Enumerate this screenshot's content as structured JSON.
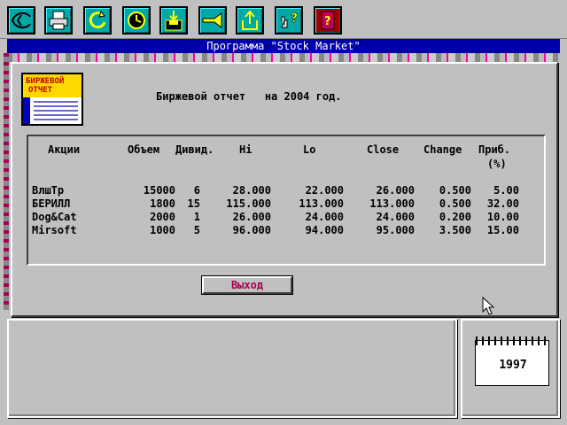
{
  "toolbar": {
    "buttons": [
      {
        "name": "exit-icon"
      },
      {
        "name": "printer-icon"
      },
      {
        "name": "refresh-icon"
      },
      {
        "name": "clock-icon"
      },
      {
        "name": "save-icon"
      },
      {
        "name": "trumpet-icon"
      },
      {
        "name": "upload-icon"
      },
      {
        "name": "help-hand-icon"
      },
      {
        "name": "book-icon"
      }
    ]
  },
  "window": {
    "title": "Программа \"Stock Market\""
  },
  "report": {
    "logo_line1": "БИРЖЕВОЙ",
    "logo_line2": "ОТЧЕТ",
    "title": "Биржевой отчет   на 2004 год."
  },
  "table": {
    "headers": {
      "stock": "Акции",
      "volume": "Объем",
      "dividend": "Дивид.",
      "hi": "Hi",
      "lo": "Lo",
      "close": "Close",
      "change": "Change",
      "profit_line1": "Приб.",
      "profit_line2": "(%)"
    },
    "rows": [
      {
        "stock": "ВлшТр",
        "volume": "15000",
        "dividend": "6",
        "hi": "28.000",
        "lo": "22.000",
        "close": "26.000",
        "change": "0.500",
        "profit": "5.00"
      },
      {
        "stock": "БЕРИЛЛ",
        "volume": "1800",
        "dividend": "15",
        "hi": "115.000",
        "lo": "113.000",
        "close": "113.000",
        "change": "0.500",
        "profit": "32.00"
      },
      {
        "stock": "Dog&Cat",
        "volume": "2000",
        "dividend": "1",
        "hi": "26.000",
        "lo": "24.000",
        "close": "24.000",
        "change": "0.200",
        "profit": "10.00"
      },
      {
        "stock": "Mirsoft",
        "volume": "1000",
        "dividend": "5",
        "hi": "96.000",
        "lo": "94.000",
        "close": "95.000",
        "change": "3.500",
        "profit": "15.00"
      }
    ]
  },
  "buttons": {
    "exit_label": "Выход"
  },
  "calendar": {
    "year": "1997"
  },
  "colors": {
    "title_bar": "#0000a8",
    "toolbar_button": "#00a8a8",
    "accent_text": "#a80050"
  }
}
